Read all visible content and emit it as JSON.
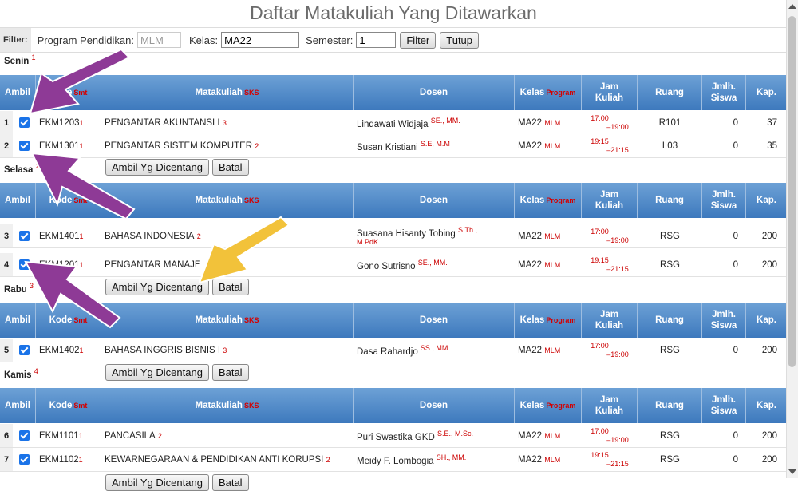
{
  "title": "Daftar Matakuliah Yang Ditawarkan",
  "filter": {
    "label": "Filter:",
    "program_label": "Program Pendidikan:",
    "program_value": "MLM",
    "kelas_label": "Kelas:",
    "kelas_value": "MA22",
    "semester_label": "Semester:",
    "semester_value": "1",
    "filter_button": "Filter",
    "tutup_button": "Tutup"
  },
  "headers": {
    "ambil": "Ambil",
    "kode": "Kode",
    "kode_sup": "Smt",
    "matakuliah": "Matakuliah",
    "matakuliah_sup": "SKS",
    "dosen": "Dosen",
    "kelas": "Kelas",
    "kelas_sup": "Program",
    "jam_1": "Jam",
    "jam_2": "Kuliah",
    "ruang": "Ruang",
    "siswa_1": "Jmlh.",
    "siswa_2": "Siswa",
    "kap": "Kap."
  },
  "actions": {
    "ambil": "Ambil Yg Dicentang",
    "batal": "Batal"
  },
  "days": [
    {
      "name": "Senin",
      "num": "1",
      "rows": [
        {
          "no": "1",
          "kode": "EKM1203",
          "smt": "1",
          "mk": "PENGANTAR AKUNTANSI I",
          "sks": "3",
          "dosen": "Lindawati Widjaja",
          "gelar": "SE., MM.",
          "kelas": "MA22",
          "prog": "MLM",
          "jam_a": "17:00",
          "jam_b": "19:00",
          "ruang": "R101",
          "siswa": "0",
          "kap": "37"
        },
        {
          "no": "2",
          "kode": "EKM1301",
          "smt": "1",
          "mk": "PENGANTAR SISTEM KOMPUTER",
          "sks": "2",
          "dosen": "Susan Kristiani",
          "gelar": "S.E, M.M",
          "kelas": "MA22",
          "prog": "MLM",
          "jam_a": "19:15",
          "jam_b": "21:15",
          "ruang": "L03",
          "siswa": "0",
          "kap": "35"
        }
      ]
    },
    {
      "name": "Selasa",
      "num": "2",
      "rows": [
        {
          "no": "3",
          "kode": "EKM1401",
          "smt": "1",
          "mk": "BAHASA INDONESIA",
          "sks": "2",
          "dosen": "Suasana Hisanty Tobing",
          "gelar": "S.Th.,",
          "gelar2": "M.PdK.",
          "kelas": "MA22",
          "prog": "MLM",
          "jam_a": "17:00",
          "jam_b": "19:00",
          "ruang": "RSG",
          "siswa": "0",
          "kap": "200"
        },
        {
          "no": "4",
          "kode": "EKM1201",
          "smt": "1",
          "mk": "PENGANTAR MANAJE",
          "sks": "",
          "dosen": "Gono Sutrisno",
          "gelar": "SE., MM.",
          "kelas": "MA22",
          "prog": "MLM",
          "jam_a": "19:15",
          "jam_b": "21:15",
          "ruang": "RSG",
          "siswa": "0",
          "kap": "200"
        }
      ]
    },
    {
      "name": "Rabu",
      "num": "3",
      "rows": [
        {
          "no": "5",
          "kode": "EKM1402",
          "smt": "1",
          "mk": "BAHASA INGGRIS BISNIS I",
          "sks": "3",
          "dosen": "Dasa Rahardjo",
          "gelar": "SS., MM.",
          "kelas": "MA22",
          "prog": "MLM",
          "jam_a": "17:00",
          "jam_b": "19:00",
          "ruang": "RSG",
          "siswa": "0",
          "kap": "200"
        }
      ]
    },
    {
      "name": "Kamis",
      "num": "4",
      "rows": [
        {
          "no": "6",
          "kode": "EKM1101",
          "smt": "1",
          "mk": "PANCASILA",
          "sks": "2",
          "dosen": "Puri Swastika GKD",
          "gelar": "S.E., M.Sc.",
          "kelas": "MA22",
          "prog": "MLM",
          "jam_a": "17:00",
          "jam_b": "19:00",
          "ruang": "RSG",
          "siswa": "0",
          "kap": "200"
        },
        {
          "no": "7",
          "kode": "EKM1102",
          "smt": "1",
          "mk": "KEWARNEGARAAN & PENDIDIKAN ANTI KORUPSI",
          "sks": "2",
          "dosen": "Meidy F. Lombogia",
          "gelar": "SH., MM.",
          "kelas": "MA22",
          "prog": "MLM",
          "jam_a": "19:15",
          "jam_b": "21:15",
          "ruang": "RSG",
          "siswa": "0",
          "kap": "200"
        }
      ]
    }
  ],
  "colors": {
    "header_top": "#6da1d6",
    "header_bottom": "#3d79bd",
    "accent_red": "#c00",
    "arrow_purple": "#8e3a96",
    "arrow_yellow": "#f2c23a",
    "checkbox": "#1a73e8"
  }
}
